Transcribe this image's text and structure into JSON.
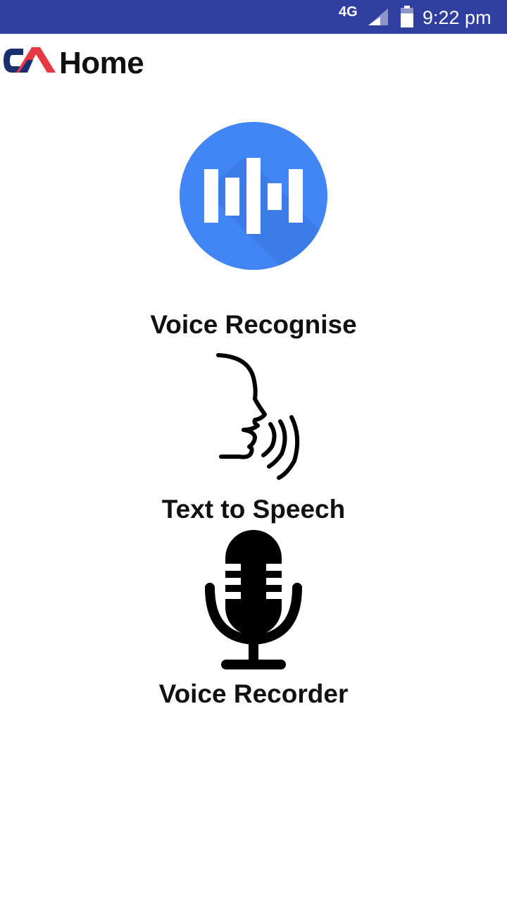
{
  "status_bar": {
    "network": "4G",
    "time": "9:22 pm",
    "signal_icon": "signal-strength-icon",
    "battery_icon": "battery-icon"
  },
  "app_bar": {
    "logo": "ca-logo",
    "title": "Home"
  },
  "features": [
    {
      "icon": "voice-waveform-icon",
      "label": "Voice Recognise"
    },
    {
      "icon": "speaking-head-icon",
      "label": "Text to Speech"
    },
    {
      "icon": "microphone-icon",
      "label": "Voice Recorder"
    }
  ],
  "colors": {
    "status_bar": "#303f9f",
    "voice_circle": "#4285f4",
    "logo_blue": "#1a2f6e",
    "logo_red": "#e63946"
  }
}
